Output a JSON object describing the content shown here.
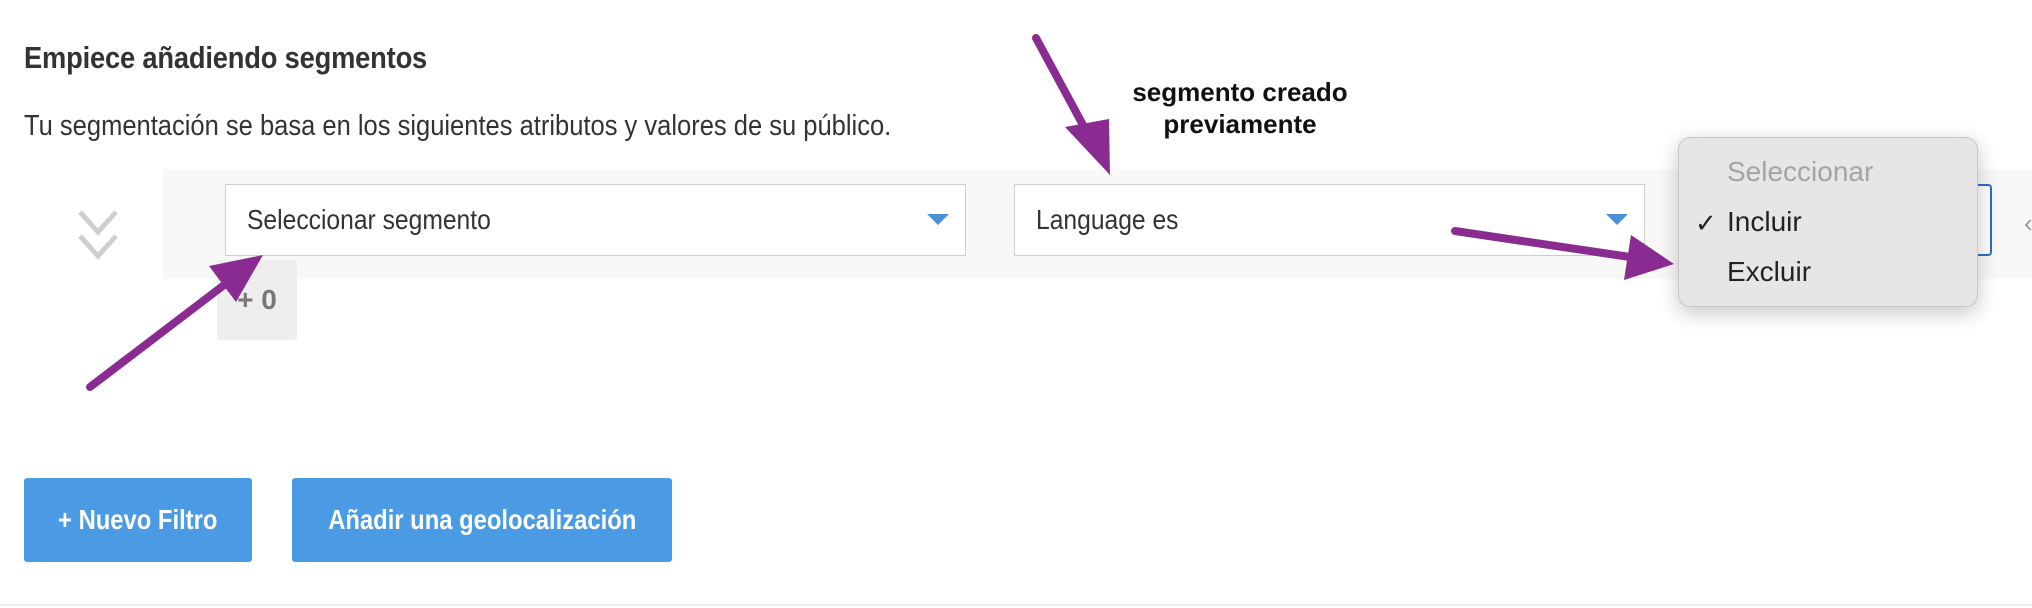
{
  "section": {
    "title": "Empiece añadiendo segmentos",
    "subtitle": "Tu segmentación se basa en los siguientes atributos y valores de su público."
  },
  "annotation": {
    "line1": "segmento creado",
    "line2": "previamente"
  },
  "filter": {
    "segment_select": {
      "value": "Seleccionar segmento"
    },
    "value_select": {
      "value": "Language es"
    },
    "count_badge": "+ 0",
    "operator_dropdown": {
      "options": [
        {
          "label": "Seleccionar",
          "disabled": true
        },
        {
          "label": "Incluir",
          "selected": true
        },
        {
          "label": "Excluir"
        }
      ],
      "check_mark": "✓"
    }
  },
  "buttons": {
    "new_filter": "+ Nuevo Filtro",
    "add_geolocation": "Añadir una geolocalización"
  },
  "colors": {
    "primary_button": "#4a9be4",
    "annotation_arrow": "#8a2b91",
    "caret": "#4a90d9",
    "focus_border": "#2e6dc6"
  }
}
